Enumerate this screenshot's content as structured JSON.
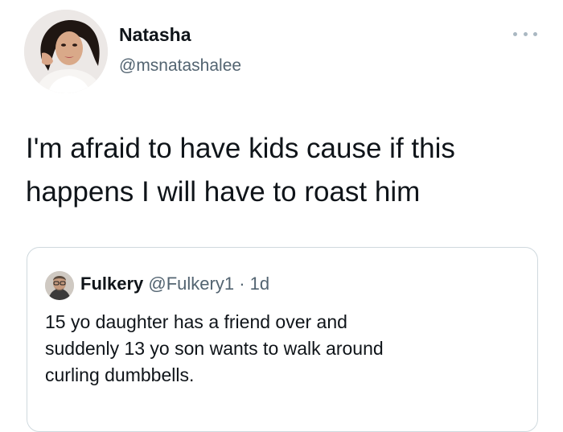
{
  "tweet": {
    "author": {
      "name": "Natasha",
      "handle": "@msnatashalee"
    },
    "text_lines": [
      "I'm afraid to have kids cause if this",
      "happens I will have to roast him"
    ],
    "more_icon": "more-dots-icon"
  },
  "quote": {
    "author": {
      "name": "Fulkery",
      "handle": "@Fulkery1",
      "separator": "·",
      "time": "1d"
    },
    "text_lines": [
      "15 yo daughter has a friend over and",
      "suddenly 13 yo son wants to walk around",
      "curling dumbbells."
    ]
  },
  "colors": {
    "text": "#0f1419",
    "secondary": "#536471",
    "border": "#cfd9de"
  }
}
